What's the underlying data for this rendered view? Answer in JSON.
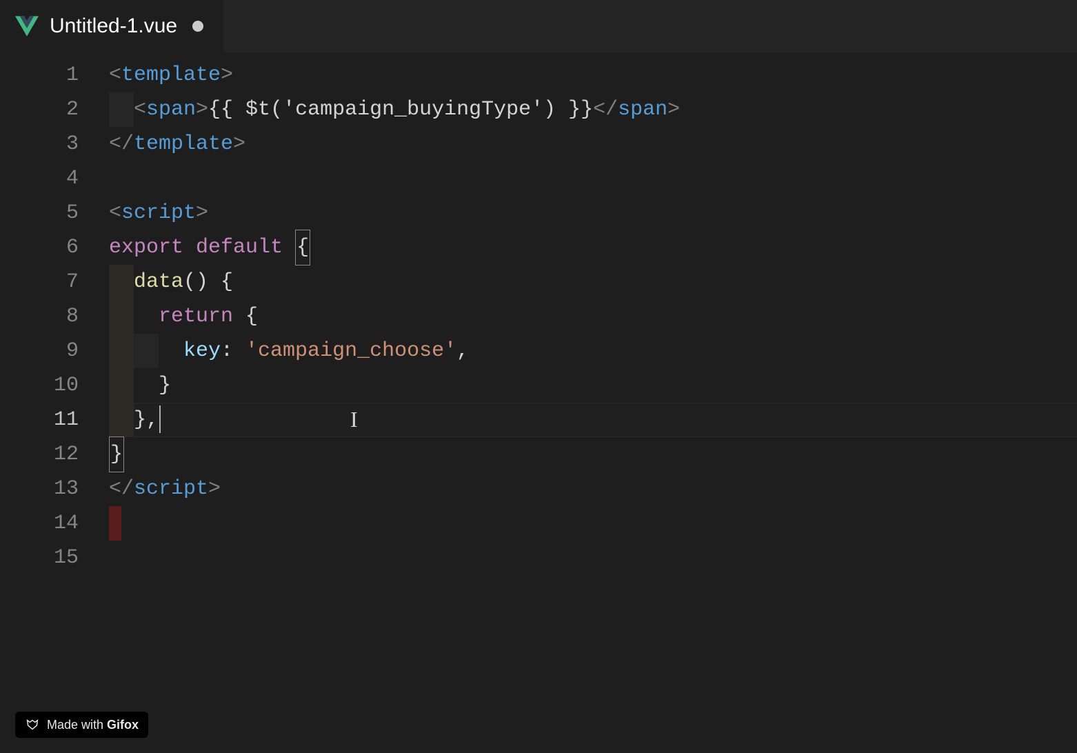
{
  "tab": {
    "title": "Untitled-1.vue",
    "dirty": true
  },
  "gutter": {
    "lines": [
      "1",
      "2",
      "3",
      "4",
      "5",
      "6",
      "7",
      "8",
      "9",
      "10",
      "11",
      "12",
      "13",
      "14",
      "15"
    ],
    "current": 11
  },
  "code": {
    "l1": {
      "open": "<",
      "tag": "template",
      "close": ">"
    },
    "l2": {
      "open": "<",
      "tag": "span",
      "close": ">",
      "text": "{{ $t('campaign_buyingType') }}",
      "copen": "</",
      "ctag": "span",
      "cclose": ">"
    },
    "l3": {
      "open": "</",
      "tag": "template",
      "close": ">"
    },
    "l5": {
      "open": "<",
      "tag": "script",
      "close": ">"
    },
    "l6": {
      "kw1": "export",
      "kw2": "default",
      "brace": "{"
    },
    "l7": {
      "fn": "data",
      "parens": "()",
      "brace": "{"
    },
    "l8": {
      "kw": "return",
      "brace": "{"
    },
    "l9": {
      "prop": "key",
      "colon": ":",
      "str": "'campaign_choose'",
      "comma": ","
    },
    "l10": {
      "brace": "}"
    },
    "l11": {
      "brace": "}",
      "comma": ","
    },
    "l12": {
      "brace": "}"
    },
    "l13": {
      "open": "</",
      "tag": "script",
      "close": ">"
    }
  },
  "watermark": {
    "prefix": "Made with ",
    "brand": "Gifox"
  }
}
